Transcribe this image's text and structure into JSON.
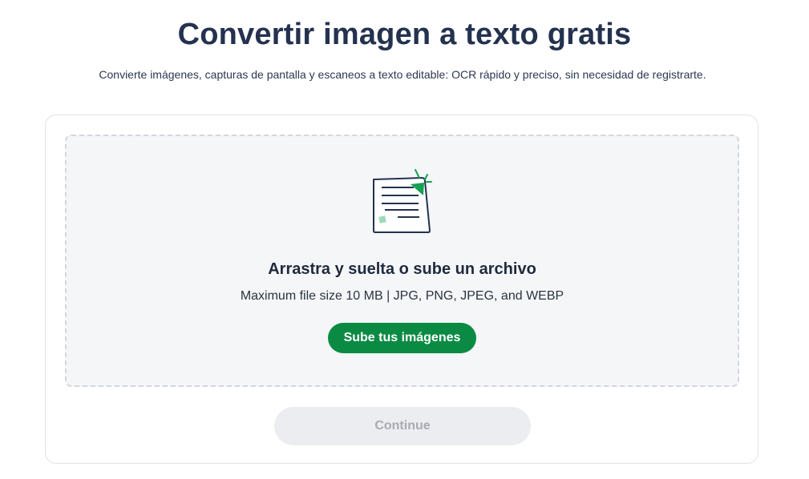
{
  "header": {
    "title": "Convertir imagen a texto gratis",
    "subtitle": "Convierte imágenes, capturas de pantalla y escaneos a texto editable: OCR rápido y preciso, sin necesidad de registrarte."
  },
  "dropzone": {
    "icon": "document-text-icon",
    "title": "Arrastra y suelta o sube un archivo",
    "info": "Maximum file size 10 MB | JPG, PNG, JPEG, and WEBP",
    "upload_label": "Sube tus imágenes"
  },
  "actions": {
    "continue_label": "Continue"
  },
  "colors": {
    "title": "#24324f",
    "accent_green": "#0a8a43",
    "dropzone_bg": "#f5f6f8",
    "disabled_bg": "#ecedf0",
    "disabled_text": "#a7abb2"
  }
}
